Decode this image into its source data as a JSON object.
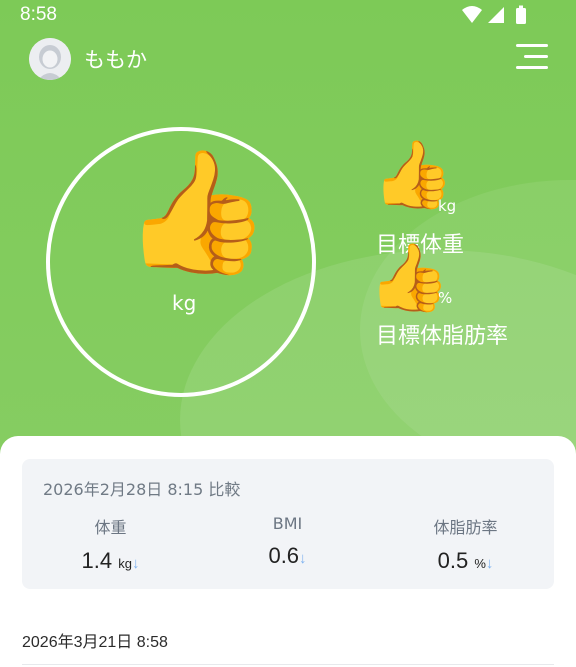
{
  "status_bar": {
    "time": "8:58",
    "icons": [
      "wifi-icon",
      "signal-icon",
      "battery-icon"
    ]
  },
  "header": {
    "username": "ももか",
    "menu_icon": "menu-icon"
  },
  "main_circle": {
    "emoji": "👍",
    "unit": "kg"
  },
  "goals": {
    "weight": {
      "emoji": "👍",
      "unit": "kg",
      "label": "目標体重"
    },
    "body_fat": {
      "emoji": "👍",
      "unit": "%",
      "label": "目標体脂肪率"
    }
  },
  "comparison": {
    "title": "2026年2月28日 8:15 比較",
    "metrics": [
      {
        "label": "体重",
        "value": "1.4",
        "unit": "kg",
        "trend": "↓"
      },
      {
        "label": "BMI",
        "value": "0.6",
        "unit": "",
        "trend": "↓"
      },
      {
        "label": "体脂肪率",
        "value": "0.5",
        "unit": "%",
        "trend": "↓"
      }
    ]
  },
  "record": {
    "date": "2026年3月21日 8:58"
  },
  "colors": {
    "header_green": "#7dca57",
    "card_bg": "#f2f4f7",
    "trend_arrow": "#7fb3f0"
  }
}
